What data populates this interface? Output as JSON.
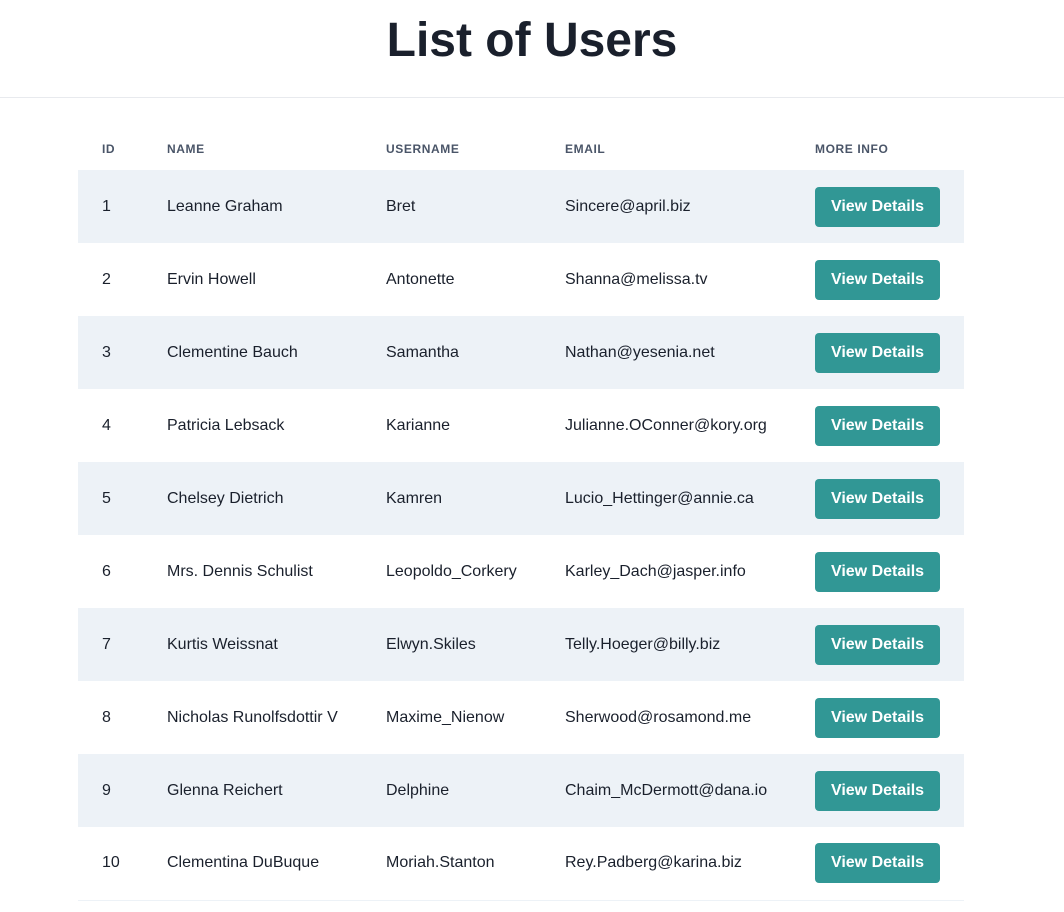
{
  "header": {
    "title": "List of Users"
  },
  "table": {
    "columns": [
      "ID",
      "NAME",
      "USERNAME",
      "EMAIL",
      "MORE INFO"
    ],
    "rows": [
      {
        "id": "1",
        "name": "Leanne Graham",
        "username": "Bret",
        "email": "Sincere@april.biz",
        "action": "View Details"
      },
      {
        "id": "2",
        "name": "Ervin Howell",
        "username": "Antonette",
        "email": "Shanna@melissa.tv",
        "action": "View Details"
      },
      {
        "id": "3",
        "name": "Clementine Bauch",
        "username": "Samantha",
        "email": "Nathan@yesenia.net",
        "action": "View Details"
      },
      {
        "id": "4",
        "name": "Patricia Lebsack",
        "username": "Karianne",
        "email": "Julianne.OConner@kory.org",
        "action": "View Details"
      },
      {
        "id": "5",
        "name": "Chelsey Dietrich",
        "username": "Kamren",
        "email": "Lucio_Hettinger@annie.ca",
        "action": "View Details"
      },
      {
        "id": "6",
        "name": "Mrs. Dennis Schulist",
        "username": "Leopoldo_Corkery",
        "email": "Karley_Dach@jasper.info",
        "action": "View Details"
      },
      {
        "id": "7",
        "name": "Kurtis Weissnat",
        "username": "Elwyn.Skiles",
        "email": "Telly.Hoeger@billy.biz",
        "action": "View Details"
      },
      {
        "id": "8",
        "name": "Nicholas Runolfsdottir V",
        "username": "Maxime_Nienow",
        "email": "Sherwood@rosamond.me",
        "action": "View Details"
      },
      {
        "id": "9",
        "name": "Glenna Reichert",
        "username": "Delphine",
        "email": "Chaim_McDermott@dana.io",
        "action": "View Details"
      },
      {
        "id": "10",
        "name": "Clementina DuBuque",
        "username": "Moriah.Stanton",
        "email": "Rey.Padberg@karina.biz",
        "action": "View Details"
      }
    ]
  },
  "colors": {
    "accent": "#319795",
    "row_alt_bg": "#edf2f7",
    "header_text": "#4a5568",
    "body_text": "#1a202c"
  }
}
